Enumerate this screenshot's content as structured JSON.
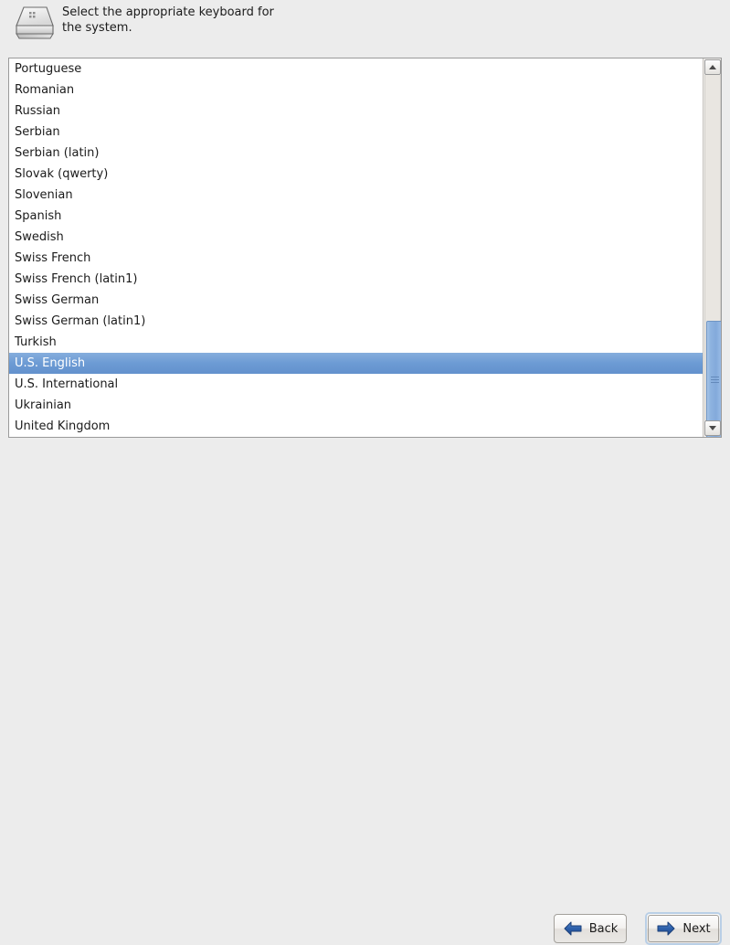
{
  "header": {
    "icon": "keyboard-key-icon",
    "text": "Select the appropriate keyboard for\nthe system."
  },
  "list": {
    "name": "keyboard-layout-list",
    "selected": "U.S. English",
    "items": [
      "Portuguese",
      "Romanian",
      "Russian",
      "Serbian",
      "Serbian (latin)",
      "Slovak (qwerty)",
      "Slovenian",
      "Spanish",
      "Swedish",
      "Swiss French",
      "Swiss French (latin1)",
      "Swiss German",
      "Swiss German (latin1)",
      "Turkish",
      "U.S. English",
      "U.S. International",
      "Ukrainian",
      "United Kingdom"
    ]
  },
  "scrollbar": {
    "up_icon": "scroll-up-arrow-icon",
    "down_icon": "scroll-down-arrow-icon"
  },
  "footer": {
    "back_label": "Back",
    "next_label": "Next",
    "back_icon": "arrow-left-icon",
    "next_icon": "arrow-right-icon"
  },
  "colors": {
    "background": "#ececec",
    "selection": "#6c9bd4",
    "selection_text": "#ffffff",
    "list_background": "#ffffff",
    "arrow_blue": "#2b5ca8"
  }
}
